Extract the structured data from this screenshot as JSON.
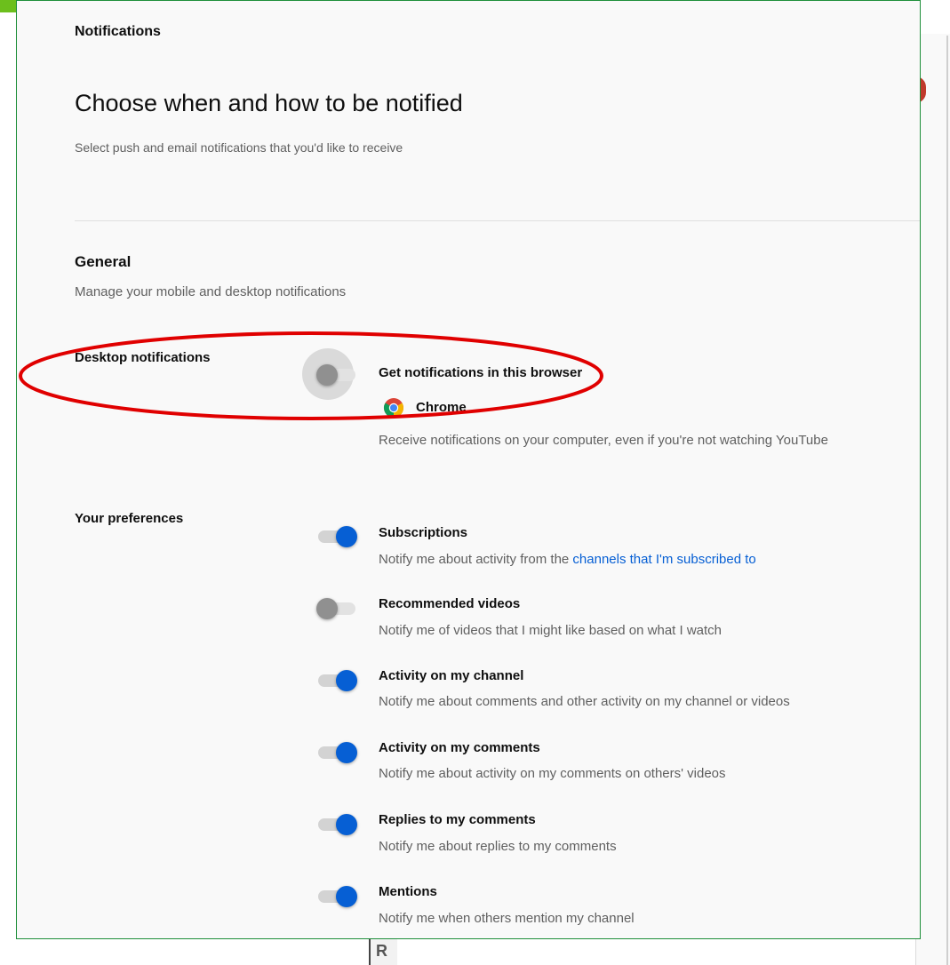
{
  "header": {
    "crumb": "Notifications",
    "title": "Choose when and how to be notified",
    "subtitle": "Select push and email notifications that you'd like to receive"
  },
  "general": {
    "title": "General",
    "subtitle": "Manage your mobile and desktop notifications"
  },
  "desktop": {
    "label": "Desktop notifications",
    "toggle_on": false,
    "title": "Get notifications in this browser",
    "browser_name": "Chrome",
    "description": "Receive notifications on your computer, even if you're not watching YouTube"
  },
  "preferences": {
    "label": "Your preferences",
    "items": [
      {
        "title": "Subscriptions",
        "desc": "Notify me about activity from the ",
        "link": "channels that I'm subscribed to",
        "on": true
      },
      {
        "title": "Recommended videos",
        "desc": "Notify me of videos that I might like based on what I watch",
        "link": "",
        "on": false
      },
      {
        "title": "Activity on my channel",
        "desc": "Notify me about comments and other activity on my channel or videos",
        "link": "",
        "on": true
      },
      {
        "title": "Activity on my comments",
        "desc": "Notify me about activity on my comments on others' videos",
        "link": "",
        "on": true
      },
      {
        "title": "Replies to my comments",
        "desc": "Notify me about replies to my comments",
        "link": "",
        "on": true
      },
      {
        "title": "Mentions",
        "desc": "Notify me when others mention my channel",
        "link": "",
        "on": true
      }
    ]
  },
  "background": {
    "cursor_letter": "R"
  },
  "colors": {
    "toggle_on": "#065fd4",
    "toggle_off": "#909090",
    "link": "#065fd4",
    "annotation": "#e00000",
    "panel_border": "#1e8f3a"
  }
}
